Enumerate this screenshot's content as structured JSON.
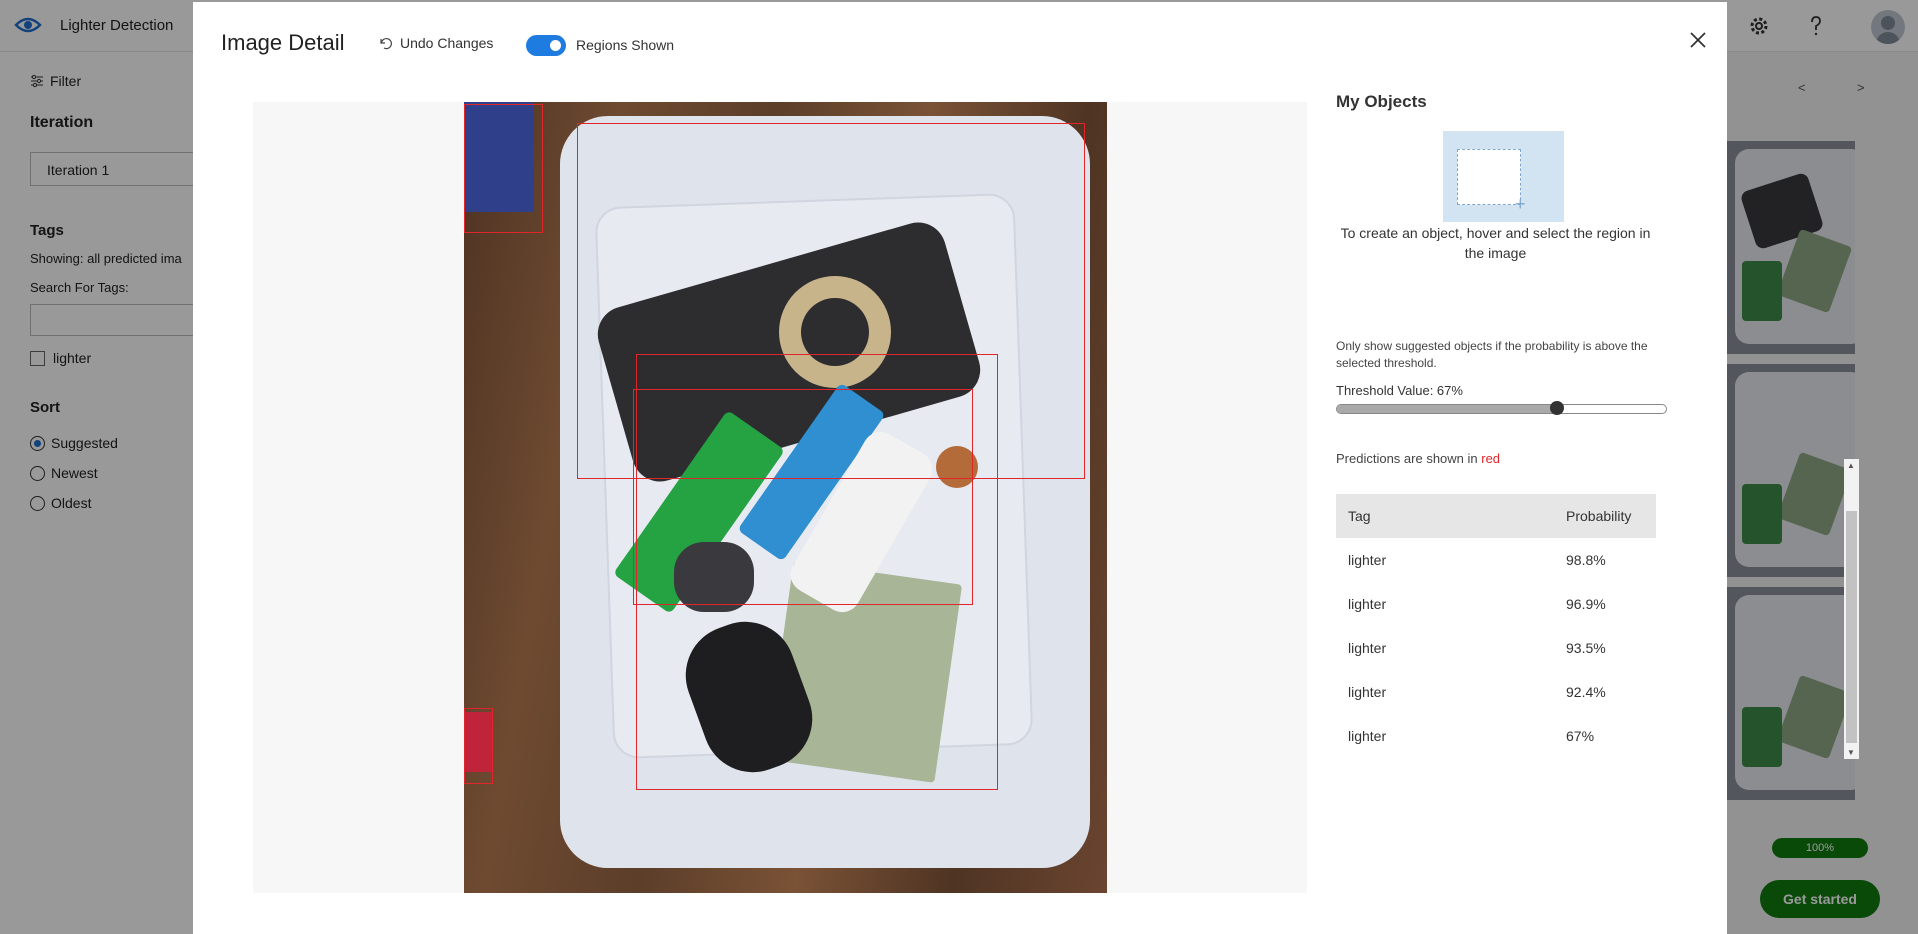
{
  "app": {
    "title": "Lighter Detection",
    "header_icons": [
      "eye-logo-icon",
      "gear-icon",
      "help-icon",
      "avatar"
    ]
  },
  "sidebar": {
    "filter_label": "Filter",
    "iteration_heading": "Iteration",
    "iteration_value": "Iteration 1",
    "tags_heading": "Tags",
    "showing_text": "Showing: all predicted ima",
    "search_label": "Search For Tags:",
    "search_value": "",
    "tag_checkbox_label": "lighter",
    "sort_heading": "Sort",
    "sort_options": [
      {
        "label": "Suggested",
        "selected": true
      },
      {
        "label": "Newest",
        "selected": false
      },
      {
        "label": "Oldest",
        "selected": false
      }
    ]
  },
  "page": {
    "pager_prev": "<",
    "pager_next": ">",
    "progress_label": "100%",
    "progress_value": 1.0,
    "get_started_label": "Get started",
    "accent_green": "#107c10"
  },
  "modal": {
    "title": "Image Detail",
    "undo_label": "Undo Changes",
    "regions_toggle_label": "Regions Shown",
    "regions_shown": true,
    "my_objects_heading": "My Objects",
    "create_hint": "To create an object, hover and select the region in the image",
    "threshold_note": "Only show suggested objects if the probability is above the selected threshold.",
    "threshold_label": "Threshold Value: 67%",
    "threshold_value": 0.67,
    "predictions_note_prefix": "Predictions are shown in ",
    "predictions_note_color_word": "red",
    "region_color": "#e0252b",
    "table": {
      "headers": [
        "Tag",
        "Probability"
      ],
      "rows": [
        {
          "tag": "lighter",
          "probability": "98.8%"
        },
        {
          "tag": "lighter",
          "probability": "96.9%"
        },
        {
          "tag": "lighter",
          "probability": "93.5%"
        },
        {
          "tag": "lighter",
          "probability": "92.4%"
        },
        {
          "tag": "lighter",
          "probability": "67%"
        }
      ]
    }
  }
}
